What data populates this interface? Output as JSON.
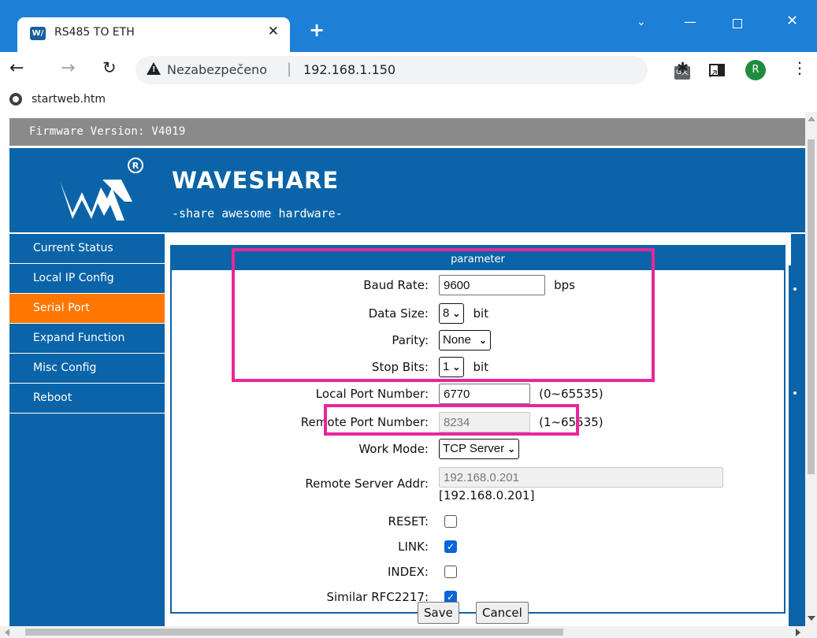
{
  "browser": {
    "tab_title": "RS485 TO ETH",
    "tab_close": "✕",
    "new_tab": "+",
    "favicon_text": "W/",
    "security_label": "Nezabezpečeno",
    "separator": "|",
    "url": "192.168.1.150",
    "avatar_letter": "R",
    "bookmark_label": "startweb.htm",
    "icons": [
      "back-arrow-icon",
      "forward-arrow-icon",
      "reload-icon",
      "warning-icon",
      "translate-icon",
      "share-icon",
      "star-icon",
      "extensions-icon",
      "side-panel-icon",
      "menu-icon"
    ]
  },
  "page": {
    "firmware": "Firmware Version:  V4019",
    "brand": "WAVESHARE",
    "tagline": "-share awesome hardware-",
    "sidebar": [
      {
        "label": "Current Status"
      },
      {
        "label": "Local IP Config"
      },
      {
        "label": "Serial Port",
        "active": true
      },
      {
        "label": "Expand Function"
      },
      {
        "label": "Misc Config"
      },
      {
        "label": "Reboot"
      }
    ],
    "panel_title": "parameter",
    "form": {
      "baud_rate": {
        "label": "Baud Rate:",
        "value": "9600",
        "unit": "bps"
      },
      "data_size": {
        "label": "Data Size:",
        "value": "8",
        "unit": "bit"
      },
      "parity": {
        "label": "Parity:",
        "value": "None"
      },
      "stop_bits": {
        "label": "Stop Bits:",
        "value": "1",
        "unit": "bit"
      },
      "local_port": {
        "label": "Local Port Number:",
        "value": "6770",
        "range": "(0~65535)"
      },
      "remote_port": {
        "label": "Remote Port Number:",
        "value": "8234",
        "range": "(1~65535)"
      },
      "work_mode": {
        "label": "Work Mode:",
        "value": "TCP Server"
      },
      "remote_server": {
        "label": "Remote Server Addr:",
        "value": "192.168.0.201",
        "current": "[192.168.0.201]"
      },
      "reset": {
        "label": "RESET:",
        "checked": false
      },
      "link": {
        "label": "LINK:",
        "checked": true
      },
      "index": {
        "label": "INDEX:",
        "checked": false
      },
      "rfc2217": {
        "label": "Similar RFC2217:",
        "checked": true
      }
    },
    "save_label": "Save",
    "cancel_label": "Cancel",
    "highlight_color": "#e8269a",
    "accent_color": "#0b64a8",
    "active_color": "#ff7700"
  }
}
